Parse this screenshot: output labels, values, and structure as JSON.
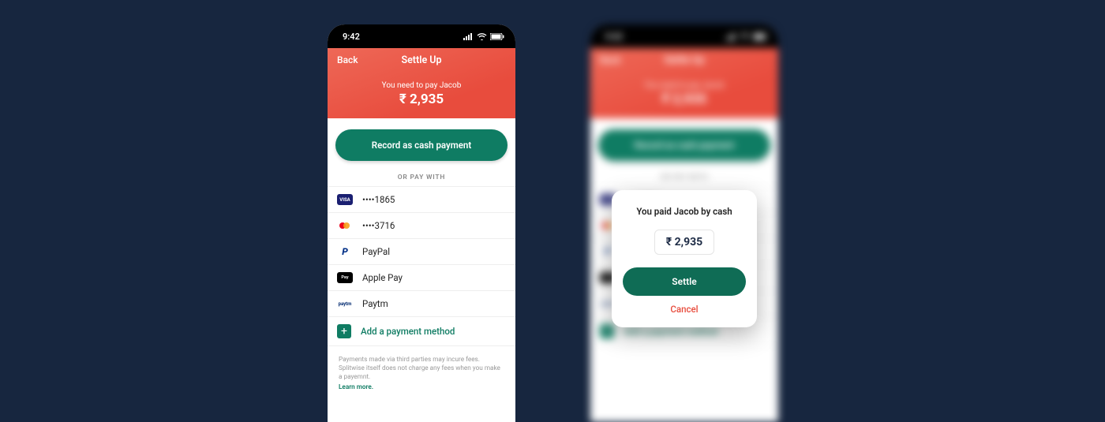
{
  "status": {
    "time": "9:42"
  },
  "header": {
    "back": "Back",
    "title": "Settle Up",
    "pay_label": "You need to pay Jacob",
    "pay_amount": "₹ 2,935"
  },
  "primary_button": "Record as cash payment",
  "or_pay_with": "OR PAY WITH",
  "methods": [
    {
      "icon": "visa",
      "label": "••••1865"
    },
    {
      "icon": "mc",
      "label": "••••3716"
    },
    {
      "icon": "paypal",
      "label": "PayPal"
    },
    {
      "icon": "applepay",
      "label": "Apple Pay"
    },
    {
      "icon": "paytm",
      "label": "Paytm"
    }
  ],
  "add_method": "Add a payment method",
  "disclaimer": "Payments made via third parties may incure fees. Splitwise itself does not charge any fees when you make a payemnt.",
  "learn_more": "Learn more.",
  "icon_text": {
    "visa": "VISA",
    "applepay": "Pay",
    "paytm": "paytm",
    "paypal": "P"
  },
  "modal": {
    "title": "You paid Jacob by cash",
    "amount": "₹ 2,935",
    "settle": "Settle",
    "cancel": "Cancel"
  }
}
